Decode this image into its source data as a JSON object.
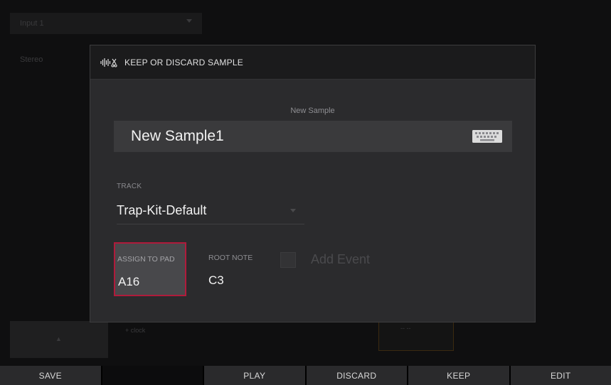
{
  "background": {
    "input_value": "Input 1",
    "channel_value": "Stereo",
    "pad_mark": "▲",
    "clock_label": "+ clock",
    "display_label": "-- --"
  },
  "modal": {
    "title": "KEEP OR DISCARD SAMPLE",
    "icon": "waveform-scissors-icon",
    "sample_caption": "New Sample",
    "sample_name": "New Sample1",
    "keyboard_icon": "keyboard-icon",
    "track_label": "TRACK",
    "track_value": "Trap-Kit-Default",
    "assign_label": "ASSIGN TO PAD",
    "assign_value": "A16",
    "root_label": "ROOT NOTE",
    "root_value": "C3",
    "event_label": "Add Event",
    "accent_color": "#b01b3b"
  },
  "bottom_bar": {
    "buttons": [
      "SAVE",
      "",
      "PLAY",
      "DISCARD",
      "KEEP",
      "EDIT"
    ]
  }
}
